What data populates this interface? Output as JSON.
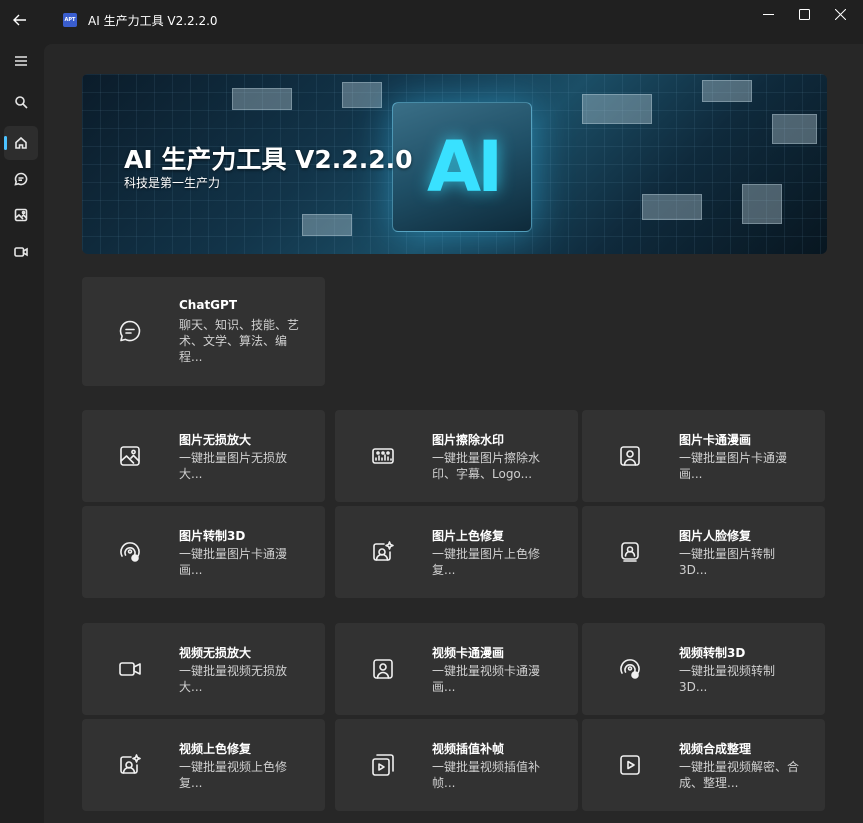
{
  "window": {
    "back": "←",
    "logo_text": "APT",
    "title": "AI 生产力工具 V2.2.2.0",
    "minimize": "—",
    "maximize": "☐",
    "close": "✕"
  },
  "sidebar": {
    "items": [
      {
        "name": "menu",
        "icon": "hamburger-icon"
      },
      {
        "name": "search",
        "icon": "search-icon"
      },
      {
        "name": "home",
        "icon": "home-icon",
        "active": true
      },
      {
        "name": "chat",
        "icon": "chat-icon"
      },
      {
        "name": "image",
        "icon": "image-icon"
      },
      {
        "name": "video",
        "icon": "video-icon"
      }
    ]
  },
  "banner": {
    "title": "AI 生产力工具 V2.2.2.0",
    "subtitle": "科技是第一生产力",
    "art_text": "AI"
  },
  "chat_section": {
    "cards": [
      {
        "title": "ChatGPT",
        "desc": "聊天、知识、技能、艺术、文学、算法、编程...",
        "icon": "chat-bubble-icon"
      }
    ]
  },
  "image_section": {
    "cards": [
      {
        "title": "图片无损放大",
        "desc": "一键批量图片无损放大...",
        "icon": "image-icon"
      },
      {
        "title": "图片擦除水印",
        "desc": "一键批量图片擦除水印、字幕、Logo...",
        "icon": "image-gallery-icon"
      },
      {
        "title": "图片卡通漫画",
        "desc": "一键批量图片卡通漫画...",
        "icon": "portrait-icon"
      },
      {
        "title": "图片转制3D",
        "desc": "一键批量图片卡通漫画...",
        "icon": "3d-person-icon"
      },
      {
        "title": "图片上色修复",
        "desc": "一键批量图片上色修复...",
        "icon": "image-sparkle-icon"
      },
      {
        "title": "图片人脸修复",
        "desc": "一键批量图片转制3D...",
        "icon": "face-portrait-icon"
      }
    ]
  },
  "video_section": {
    "cards": [
      {
        "title": "视频无损放大",
        "desc": "一键批量视频无损放大...",
        "icon": "video-camera-icon"
      },
      {
        "title": "视频卡通漫画",
        "desc": "一键批量视频卡通漫画...",
        "icon": "portrait-icon"
      },
      {
        "title": "视频转制3D",
        "desc": "一键批量视频转制3D...",
        "icon": "3d-person-icon"
      },
      {
        "title": "视频上色修复",
        "desc": "一键批量视频上色修复...",
        "icon": "image-sparkle-icon"
      },
      {
        "title": "视频插值补帧",
        "desc": "一键批量视频插值补帧...",
        "icon": "video-frames-icon"
      },
      {
        "title": "视频合成整理",
        "desc": "一键批量视频解密、合成、整理...",
        "icon": "play-icon"
      }
    ]
  },
  "colors": {
    "background": "#202020",
    "content": "#272727",
    "card": "#323232",
    "accent": "#4cc2ff"
  }
}
